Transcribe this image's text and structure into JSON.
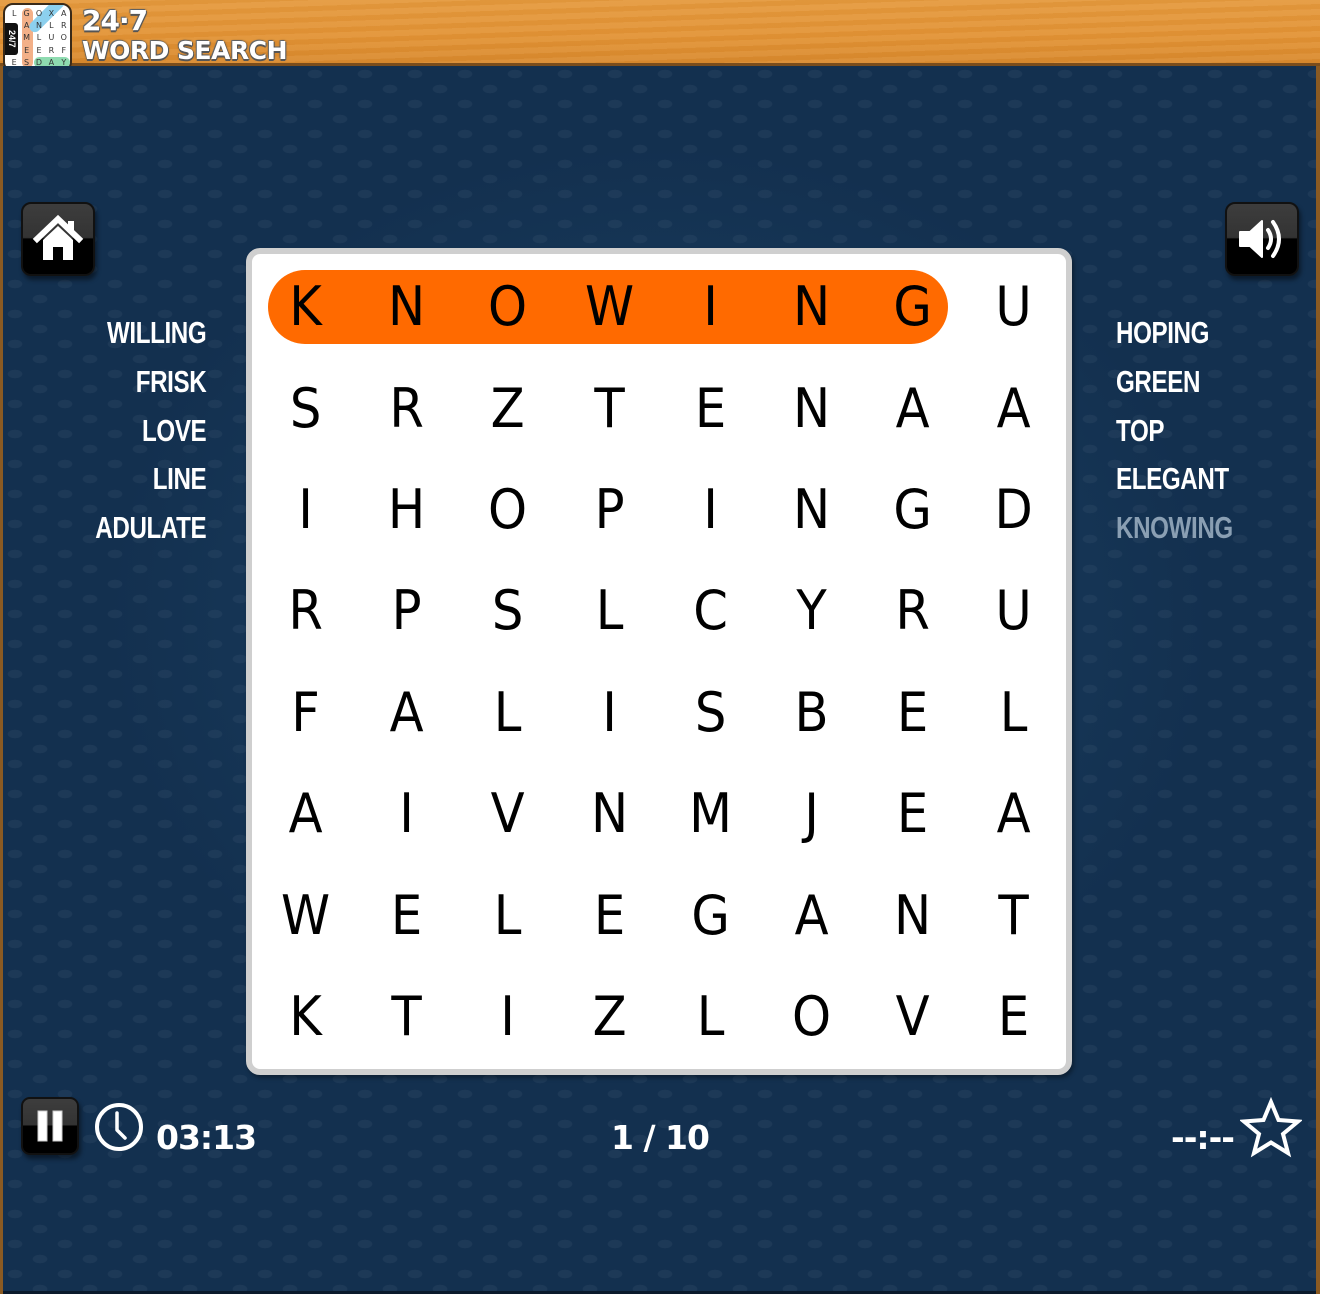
{
  "app": {
    "title_line1": "24·7",
    "title_line2": "WORD SEARCH",
    "logo": {
      "tab_label": "24/7",
      "grid": [
        [
          "L",
          "G",
          "O",
          "X",
          "A"
        ],
        [
          "",
          "A",
          "N",
          "L",
          "R"
        ],
        [
          "",
          "M",
          "L",
          "U",
          "O"
        ],
        [
          "",
          "E",
          "E",
          "R",
          "F"
        ],
        [
          "E",
          "S",
          "D",
          "A",
          "Y"
        ]
      ]
    }
  },
  "controls": {
    "home_icon": "home-icon",
    "sound_icon": "speaker-icon",
    "pause_icon": "pause-icon",
    "clock_icon": "clock-icon",
    "star_icon": "star-icon"
  },
  "words_left": [
    {
      "word": "WILLING",
      "found": false
    },
    {
      "word": "FRISK",
      "found": false
    },
    {
      "word": "LOVE",
      "found": false
    },
    {
      "word": "LINE",
      "found": false
    },
    {
      "word": "ADULATE",
      "found": false
    }
  ],
  "words_right": [
    {
      "word": "HOPING",
      "found": false
    },
    {
      "word": "GREEN",
      "found": false
    },
    {
      "word": "TOP",
      "found": false
    },
    {
      "word": "ELEGANT",
      "found": false
    },
    {
      "word": "KNOWING",
      "found": true
    }
  ],
  "grid": [
    [
      "K",
      "N",
      "O",
      "W",
      "I",
      "N",
      "G",
      "U"
    ],
    [
      "S",
      "R",
      "Z",
      "T",
      "E",
      "N",
      "A",
      "A"
    ],
    [
      "I",
      "H",
      "O",
      "P",
      "I",
      "N",
      "G",
      "D"
    ],
    [
      "R",
      "P",
      "S",
      "L",
      "C",
      "Y",
      "R",
      "U"
    ],
    [
      "F",
      "A",
      "L",
      "I",
      "S",
      "B",
      "E",
      "L"
    ],
    [
      "A",
      "I",
      "V",
      "N",
      "M",
      "J",
      "E",
      "A"
    ],
    [
      "W",
      "E",
      "L",
      "E",
      "G",
      "A",
      "N",
      "T"
    ],
    [
      "K",
      "T",
      "I",
      "Z",
      "L",
      "O",
      "V",
      "E"
    ]
  ],
  "highlight": {
    "word": "KNOWING",
    "color": "#ff6a00",
    "start": [
      0,
      0
    ],
    "end": [
      0,
      6
    ]
  },
  "status": {
    "timer": "03:13",
    "progress": "1 / 10",
    "best_time": "--:--"
  },
  "colors": {
    "board_bg": "#13304f",
    "found_word": "#8a9fb3",
    "grid_border": "#cfcfcf"
  }
}
